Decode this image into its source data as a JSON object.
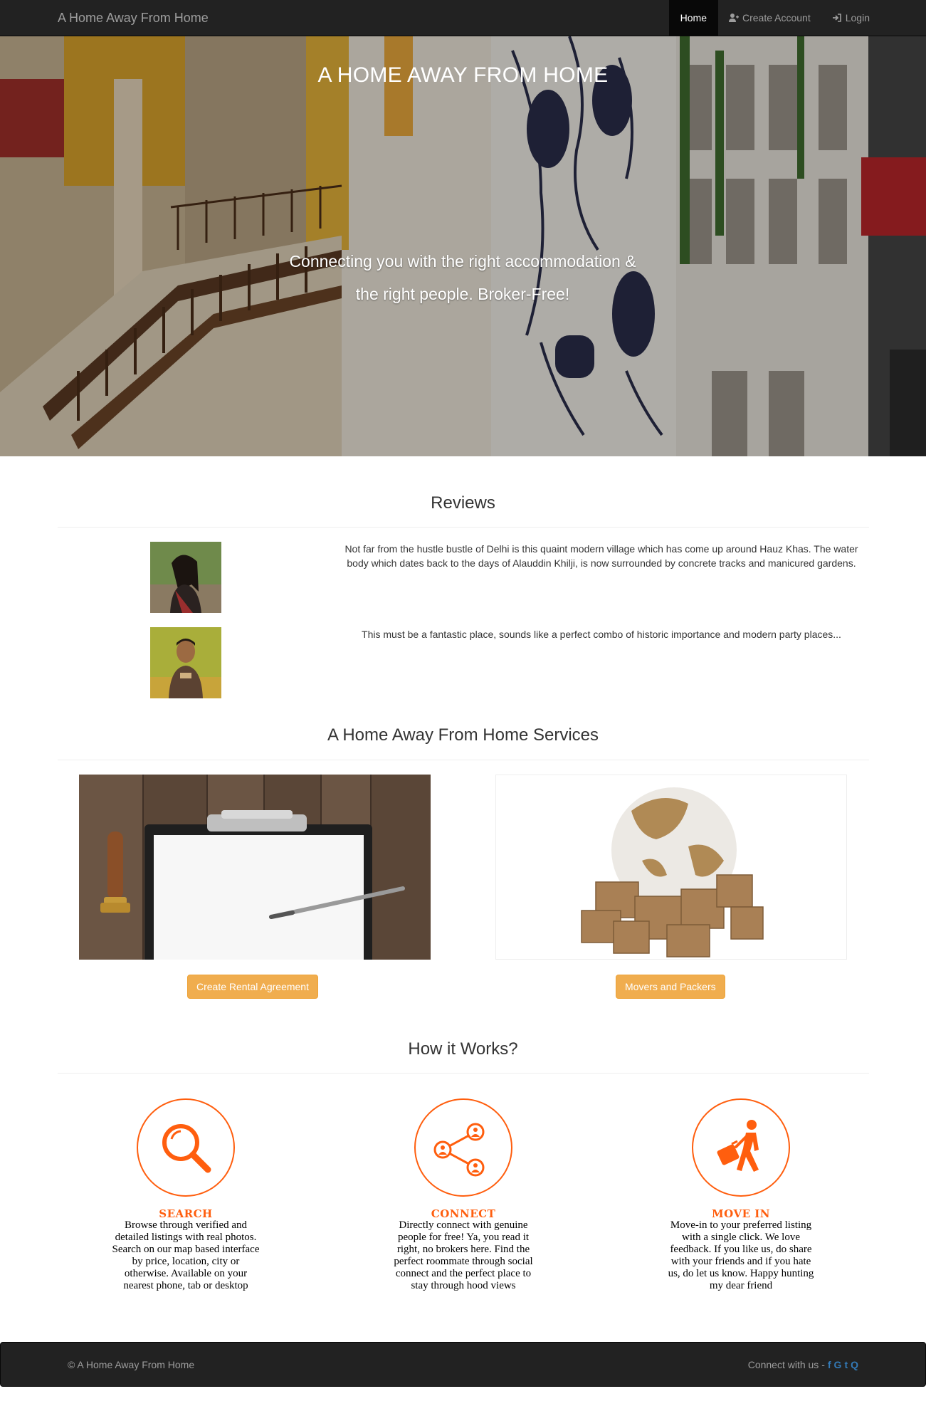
{
  "navbar": {
    "brand": "A Home Away From Home",
    "items": [
      {
        "label": "Home",
        "active": true,
        "icon": ""
      },
      {
        "label": "Create Account",
        "active": false,
        "icon": "user-plus-icon"
      },
      {
        "label": "Login",
        "active": false,
        "icon": "sign-in-icon"
      }
    ]
  },
  "hero": {
    "title": "A HOME AWAY FROM HOME",
    "subtitle_line1": "Connecting you with the right accommodation &",
    "subtitle_line2": "the right people. Broker-Free!"
  },
  "reviews": {
    "title": "Reviews",
    "items": [
      {
        "text": "Not far from the hustle bustle of Delhi is this quaint modern village which has come up around Hauz Khas. The water body which dates back to the days of Alauddin Khilji, is now surrounded by concrete tracks and manicured gardens."
      },
      {
        "text": "This must be a fantastic place, sounds like a perfect combo of historic importance and modern party places..."
      }
    ]
  },
  "services": {
    "title": "A Home Away From Home Services",
    "items": [
      {
        "button": "Create Rental Agreement"
      },
      {
        "button": "Movers and Packers"
      }
    ]
  },
  "how": {
    "title": "How it Works?",
    "steps": [
      {
        "title": "SEARCH",
        "icon": "search-icon",
        "text": "Browse through verified and detailed listings with real photos. Search on our map based interface by price, location, city or otherwise. Available on your nearest phone, tab or desktop"
      },
      {
        "title": "CONNECT",
        "icon": "share-people-icon",
        "text": "Directly connect with genuine people for free! Ya, you read it right, no brokers here. Find the perfect roommate through social connect and the perfect place to stay through hood views"
      },
      {
        "title": "MOVE IN",
        "icon": "traveler-luggage-icon",
        "text": "Move-in to your preferred listing with a single click. We love feedback. If you like us, do share with your friends and if you hate us, do let us know. Happy hunting my dear friend"
      }
    ]
  },
  "footer": {
    "copyright": "© A Home Away From Home",
    "connect": "Connect with us -",
    "social": [
      "f",
      "G",
      "t",
      "Q"
    ]
  },
  "colors": {
    "navbar": "#222222",
    "accent_orange": "#ff5e0e",
    "button_warning": "#f0ad4e",
    "social_blue": "#337ab7"
  }
}
